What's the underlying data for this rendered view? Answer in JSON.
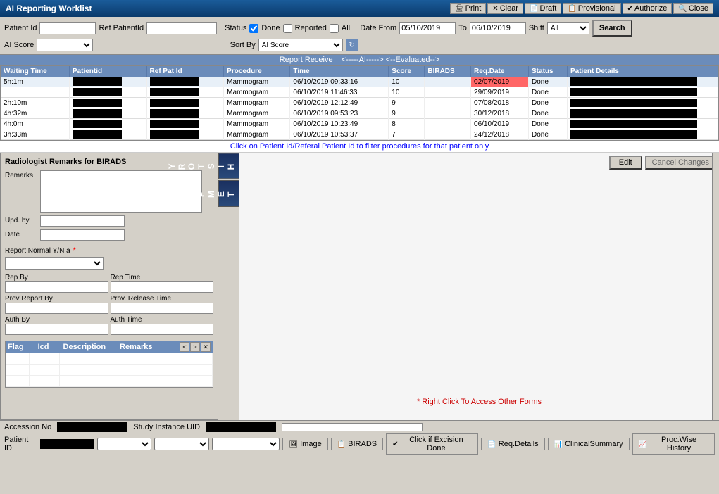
{
  "titleBar": {
    "title": "AI Reporting Worklist",
    "buttons": [
      "Print",
      "Clear",
      "Draft",
      "Provisional",
      "Authorize",
      "Close"
    ]
  },
  "searchBar": {
    "patientIdLabel": "Patient Id",
    "refPatientIdLabel": "Ref PatientId",
    "statusLabel": "Status",
    "doneLabel": "Done",
    "reportedLabel": "Reported",
    "allLabel": "All",
    "dateFromLabel": "Date From",
    "dateFromValue": "05/10/2019",
    "dateToLabel": "To",
    "dateToValue": "06/10/2019",
    "shiftLabel": "Shift",
    "shiftValue": "All",
    "searchBtn": "Search",
    "aiScoreLabel": "AI Score",
    "sortByLabel": "Sort By",
    "sortByValue": "AI Score"
  },
  "tableHeader": {
    "arrowLine": "<-----AI-----> <--Evaluated-->",
    "reportReceiveLabel": "Report Receive",
    "columns": [
      "Waiting Time",
      "Patientid",
      "Ref Pat Id",
      "Procedure",
      "Time",
      "Score",
      "BIRADS",
      "Req.Date",
      "Status",
      "Patient Details"
    ]
  },
  "tableRows": [
    {
      "waitingTime": "5h:1m",
      "patientId": "",
      "refPatId": "",
      "procedure": "Mammogram",
      "time": "06/10/2019 09:33:16",
      "score": "10",
      "birads": "",
      "reqDate": "02/07/2019",
      "status": "Done",
      "patientDetails": "",
      "redDate": true
    },
    {
      "waitingTime": "",
      "patientId": "",
      "refPatId": "",
      "procedure": "Mammogram",
      "time": "06/10/2019 11:46:33",
      "score": "10",
      "birads": "",
      "reqDate": "29/09/2019",
      "status": "Done",
      "patientDetails": ""
    },
    {
      "waitingTime": "2h:10m",
      "patientId": "",
      "refPatId": "",
      "procedure": "Mammogram",
      "time": "06/10/2019 12:12:49",
      "score": "9",
      "birads": "",
      "reqDate": "07/08/2018",
      "status": "Done",
      "patientDetails": ""
    },
    {
      "waitingTime": "4h:32m",
      "patientId": "",
      "refPatId": "",
      "procedure": "Mammogram",
      "time": "06/10/2019 09:53:23",
      "score": "9",
      "birads": "",
      "reqDate": "30/12/2018",
      "status": "Done",
      "patientDetails": ""
    },
    {
      "waitingTime": "4h:0m",
      "patientId": "",
      "refPatId": "",
      "procedure": "Mammogram",
      "time": "06/10/2019 10:23:49",
      "score": "8",
      "birads": "",
      "reqDate": "06/10/2019",
      "status": "Done",
      "patientDetails": ""
    },
    {
      "waitingTime": "3h:33m",
      "patientId": "",
      "refPatId": "",
      "procedure": "Mammogram",
      "time": "06/10/2019 10:53:37",
      "score": "7",
      "birads": "",
      "reqDate": "24/12/2018",
      "status": "Done",
      "patientDetails": ""
    }
  ],
  "noticeBar": {
    "text": "Click on Patient Id/Referal Patient Id to filter procedures for that patient only"
  },
  "biradsPanel": {
    "title": "Radiologist Remarks for BIRADS",
    "remarksLabel": "Remarks",
    "updByLabel": "Upd. by",
    "dateLabel": "Date",
    "reportNormalLabel": "Report Normal Y/N a",
    "repByLabel": "Rep By",
    "repTimeLabel": "Rep Time",
    "provReportByLabel": "Prov Report By",
    "provReleaseTimeLabel": "Prov. Release Time",
    "authByLabel": "Auth By",
    "authTimeLabel": "Auth Time"
  },
  "icdSection": {
    "columns": [
      "Flag",
      "Icd",
      "Description",
      "Remarks"
    ]
  },
  "rightPanel": {
    "editBtn": "Edit",
    "cancelBtn": "Cancel Changes",
    "rightClickNotice": "* Right Click To Access Other Forms"
  },
  "verticalTabs": {
    "history": "H I S T O R Y",
    "template": "T E M P L A T E"
  },
  "bottomBar": {
    "accessionNoLabel": "Accession No",
    "studyInstanceLabel": "Study Instance UID",
    "patientIdLabel": "Patient ID",
    "tabs": [
      "Image",
      "BIRADS",
      "Click if Excision Done",
      "Req.Details",
      "ClinicalSummary",
      "Proc.Wise History"
    ]
  }
}
